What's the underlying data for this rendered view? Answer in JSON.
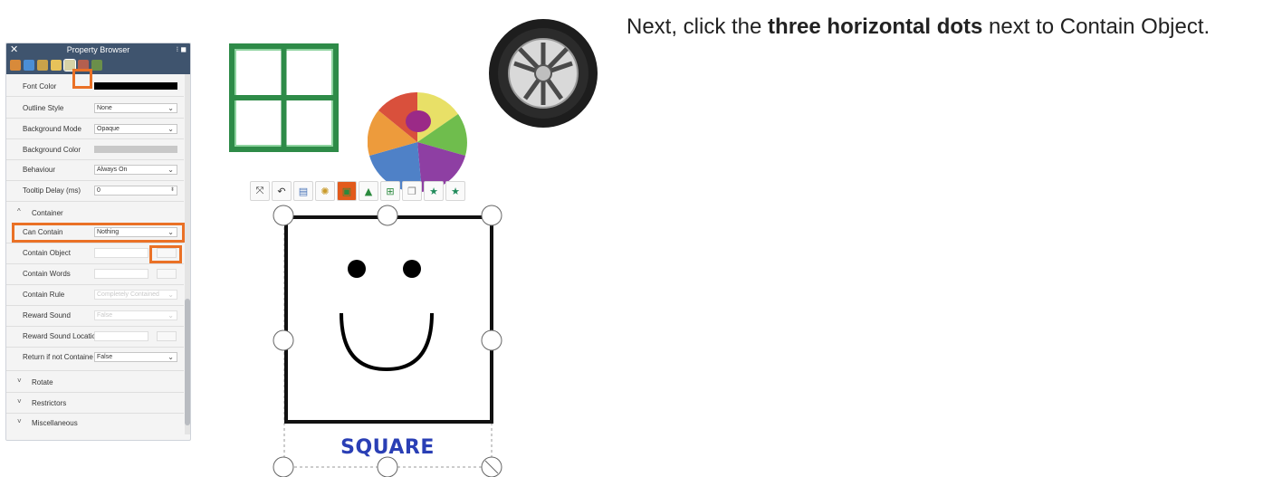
{
  "property_browser": {
    "title": "Property Browser",
    "close_glyph": "✕",
    "controls_glyph": "⁝ ◼",
    "toolbar_icons": [
      {
        "name": "picture-icon",
        "color": "#d88a3a"
      },
      {
        "name": "paint-icon",
        "color": "#4a8ed6"
      },
      {
        "name": "house-icon",
        "color": "#c9a24a"
      },
      {
        "name": "note-icon",
        "color": "#e7c25a"
      },
      {
        "name": "container-icon",
        "color": "#d7d2a6"
      },
      {
        "name": "puppet-icon",
        "color": "#b45f4f"
      },
      {
        "name": "person-icon",
        "color": "#6b8f4a"
      }
    ],
    "rows": {
      "font_color": {
        "label": "Font Color"
      },
      "outline_style": {
        "label": "Outline Style",
        "value": "None"
      },
      "background_mode": {
        "label": "Background Mode",
        "value": "Opaque"
      },
      "background_color": {
        "label": "Background Color"
      },
      "behaviour": {
        "label": "Behaviour",
        "value": "Always On"
      },
      "tooltip_delay": {
        "label": "Tooltip Delay (ms)",
        "value": "0"
      },
      "can_contain": {
        "label": "Can Contain",
        "value": "Nothing"
      },
      "contain_object": {
        "label": "Contain Object",
        "value": ""
      },
      "contain_words": {
        "label": "Contain Words",
        "value": ""
      },
      "contain_rule": {
        "label": "Contain Rule",
        "value": "Completely Contained"
      },
      "reward_sound": {
        "label": "Reward Sound",
        "value": "False"
      },
      "reward_sound_location": {
        "label": "Reward Sound Locatio",
        "value": ""
      },
      "return_if_not_contained": {
        "label": "Return if not Containe",
        "value": "False"
      }
    },
    "sections": {
      "container": {
        "caret": "^",
        "label": "Container"
      },
      "rotate": {
        "caret": "˅",
        "label": "Rotate"
      },
      "restrictors": {
        "caret": "˅",
        "label": "Restrictors"
      },
      "miscellaneous": {
        "caret": "˅",
        "label": "Miscellaneous"
      }
    },
    "dropdown_glyph": "⌄",
    "spin_glyph": "⬍"
  },
  "instruction": {
    "prefix": "Next, click the ",
    "bold": "three horizontal dots",
    "suffix": " next to Contain Object."
  },
  "object_toolbar": [
    {
      "name": "fullscreen-icon",
      "glyph": "⤧"
    },
    {
      "name": "undo-icon",
      "glyph": "↶"
    },
    {
      "name": "properties-icon",
      "glyph": "▤"
    },
    {
      "name": "sparkle-icon",
      "glyph": "✺"
    },
    {
      "name": "layers-icon",
      "glyph": "▣"
    },
    {
      "name": "align-up-icon",
      "glyph": "▲"
    },
    {
      "name": "align-grid-icon",
      "glyph": "⊞"
    },
    {
      "name": "copy-icon",
      "glyph": "❐"
    },
    {
      "name": "star-up-icon",
      "glyph": "★"
    },
    {
      "name": "star-down-icon",
      "glyph": "★"
    }
  ],
  "square_label": "SQUARE",
  "colors": {
    "highlight": "#ea7126",
    "panel_header": "#3f546e",
    "window_frame": "#2e8b48",
    "label_blue": "#2a3fb5"
  }
}
